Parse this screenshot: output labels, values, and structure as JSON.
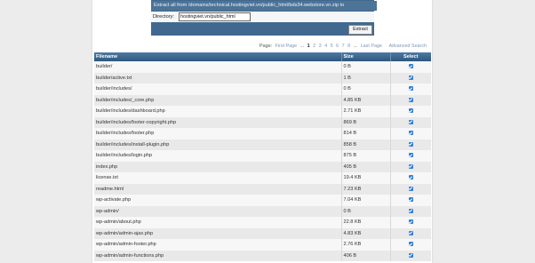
{
  "extract": {
    "header_text": "Extract all from /domains/technical.hostingviet.vn/public_html/bds34.webstore.vn.zip to",
    "directory_label": "Directory:",
    "directory_value": "hostingviet.vn/public_html",
    "button_label": "Extract"
  },
  "pagination": {
    "label": "Page:",
    "first": "First Page",
    "ellipsis_start": "...",
    "current": "1",
    "pages": [
      "2",
      "3",
      "4",
      "5",
      "6",
      "7",
      "8"
    ],
    "ellipsis_end": "...",
    "last": "Last Page",
    "advanced_search": "Advanced Search"
  },
  "table": {
    "headers": {
      "filename": "Filename",
      "size": "Size",
      "select": "Select"
    },
    "rows": [
      {
        "filename": "builder/",
        "size": "0 B",
        "checked": true
      },
      {
        "filename": "builder/active.txt",
        "size": "1 B",
        "checked": true
      },
      {
        "filename": "builder/includes/",
        "size": "0 B",
        "checked": true
      },
      {
        "filename": "builder/includes/_core.php",
        "size": "4.85 KB",
        "checked": true
      },
      {
        "filename": "builder/includes/dashboard.php",
        "size": "2.71 KB",
        "checked": true
      },
      {
        "filename": "builder/includes/footer-copyright.php",
        "size": "869 B",
        "checked": true
      },
      {
        "filename": "builder/includes/footer.php",
        "size": "814 B",
        "checked": true
      },
      {
        "filename": "builder/includes/install-plugin.php",
        "size": "858 B",
        "checked": true
      },
      {
        "filename": "builder/includes/login.php",
        "size": "875 B",
        "checked": true
      },
      {
        "filename": "index.php",
        "size": "405 B",
        "checked": true
      },
      {
        "filename": "license.txt",
        "size": "19.4 KB",
        "checked": true
      },
      {
        "filename": "readme.html",
        "size": "7.23 KB",
        "checked": true
      },
      {
        "filename": "wp-activate.php",
        "size": "7.04 KB",
        "checked": true
      },
      {
        "filename": "wp-admin/",
        "size": "0 B",
        "checked": true
      },
      {
        "filename": "wp-admin/about.php",
        "size": "22.8 KB",
        "checked": true
      },
      {
        "filename": "wp-admin/admin-ajax.php",
        "size": "4.83 KB",
        "checked": true
      },
      {
        "filename": "wp-admin/admin-footer.php",
        "size": "2.76 KB",
        "checked": true
      },
      {
        "filename": "wp-admin/admin-functions.php",
        "size": "406 B",
        "checked": true
      }
    ]
  },
  "colors": {
    "panel_blue": "#41688f",
    "header_blue": "#2e577e",
    "checkbox_blue": "#2f7fd6",
    "link_gray_blue": "#7f97b2"
  }
}
